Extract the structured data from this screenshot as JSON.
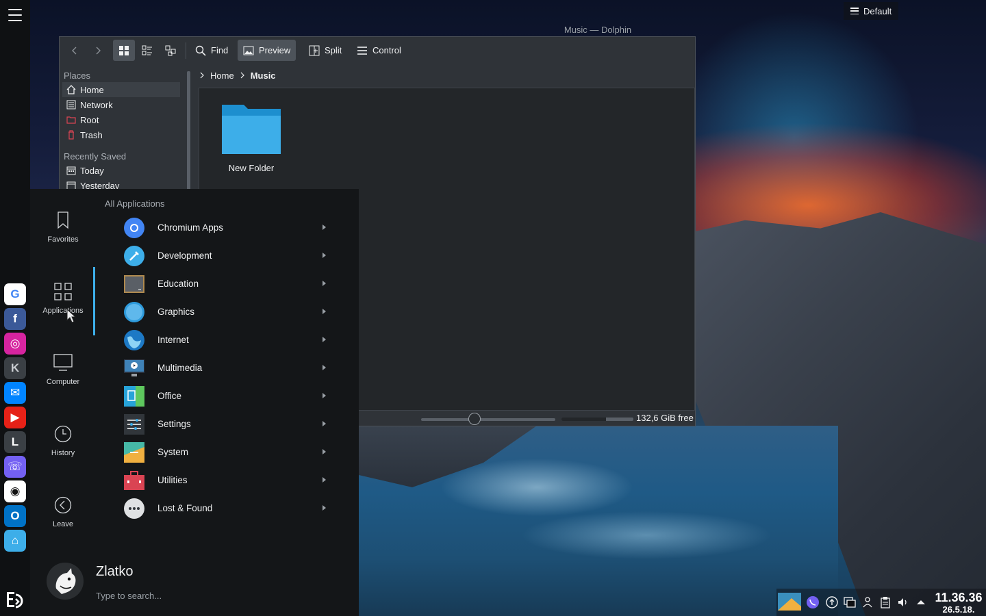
{
  "desktop": {
    "activity_label": "Default"
  },
  "left_panel": {
    "launchers": [
      {
        "name": "google",
        "glyph": "G",
        "color": "#ffffff",
        "fg": "#4285f4"
      },
      {
        "name": "facebook",
        "glyph": "f",
        "color": "#3b5998",
        "fg": "#ffffff"
      },
      {
        "name": "instagram",
        "glyph": "◎",
        "color": "#d6249f",
        "fg": "#ffffff"
      },
      {
        "name": "kdeconnect",
        "glyph": "K",
        "color": "#3a3f44",
        "fg": "#c9cdd1"
      },
      {
        "name": "messenger",
        "glyph": "✉",
        "color": "#0084ff",
        "fg": "#ffffff"
      },
      {
        "name": "youtube",
        "glyph": "▶",
        "color": "#e62117",
        "fg": "#ffffff"
      },
      {
        "name": "libreoffice",
        "glyph": "L",
        "color": "#3a3f44",
        "fg": "#ffffff"
      },
      {
        "name": "viber",
        "glyph": "☏",
        "color": "#7360f2",
        "fg": "#ffffff"
      },
      {
        "name": "github",
        "glyph": "◉",
        "color": "#ffffff",
        "fg": "#111111"
      },
      {
        "name": "outlook",
        "glyph": "O",
        "color": "#0072c6",
        "fg": "#ffffff"
      },
      {
        "name": "home-folder",
        "glyph": "⌂",
        "color": "#3daee9",
        "fg": "#ffffff"
      }
    ]
  },
  "dolphin": {
    "window_title": "Music — Dolphin",
    "toolbar": {
      "find": "Find",
      "preview": "Preview",
      "split": "Split",
      "control": "Control"
    },
    "places": {
      "header": "Places",
      "items": [
        {
          "label": "Home",
          "icon": "home-icon"
        },
        {
          "label": "Network",
          "icon": "network-icon"
        },
        {
          "label": "Root",
          "icon": "root-folder-icon"
        },
        {
          "label": "Trash",
          "icon": "trash-icon"
        }
      ],
      "recent_header": "Recently Saved",
      "recent_items": [
        {
          "label": "Today",
          "icon": "calendar-icon"
        },
        {
          "label": "Yesterday",
          "icon": "calendar-icon"
        }
      ]
    },
    "breadcrumb": {
      "home": "Home",
      "current": "Music"
    },
    "files": [
      {
        "name": "New Folder",
        "icon": "folder-icon"
      }
    ],
    "status": {
      "free_space": "132,6 GiB free",
      "used_fraction": 0.38,
      "zoom_fraction": 0.4
    }
  },
  "launcher": {
    "tabs": {
      "favorites": "Favorites",
      "applications": "Applications",
      "computer": "Computer",
      "history": "History",
      "leave": "Leave"
    },
    "header": "All Applications",
    "categories": [
      {
        "label": "Chromium Apps",
        "icon": "chromium-icon",
        "color": "#4285f4"
      },
      {
        "label": "Development",
        "icon": "development-icon",
        "color": "#3daee9"
      },
      {
        "label": "Education",
        "icon": "education-icon",
        "color": "#5a5f66"
      },
      {
        "label": "Graphics",
        "icon": "graphics-icon",
        "color": "#2e9bdc"
      },
      {
        "label": "Internet",
        "icon": "internet-icon",
        "color": "#1d79c5"
      },
      {
        "label": "Multimedia",
        "icon": "multimedia-icon",
        "color": "#2b3340"
      },
      {
        "label": "Office",
        "icon": "office-icon",
        "color": "#27a3d9"
      },
      {
        "label": "Settings",
        "icon": "settings-icon",
        "color": "#31363b"
      },
      {
        "label": "System",
        "icon": "system-icon",
        "color": "#46b8a6"
      },
      {
        "label": "Utilities",
        "icon": "utilities-icon",
        "color": "#da4453"
      },
      {
        "label": "Lost & Found",
        "icon": "lost-found-icon",
        "color": "#dfe1e3"
      }
    ],
    "user": {
      "name": "Zlatko",
      "search_placeholder": "Type to search..."
    }
  },
  "tray": {
    "time": "11.36.36",
    "date": "26.5.18."
  }
}
